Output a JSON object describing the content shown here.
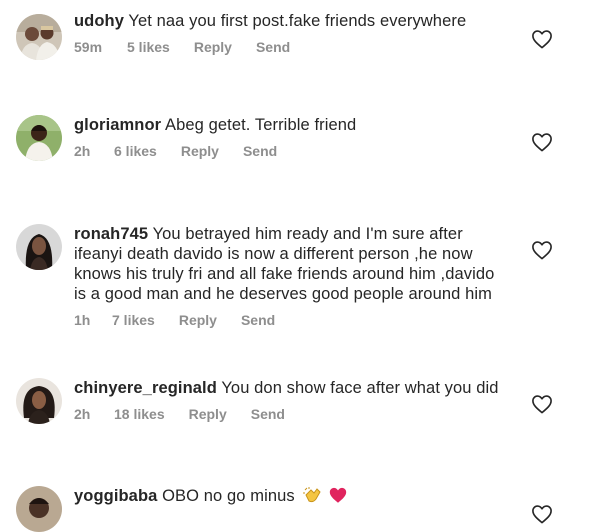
{
  "comments": [
    {
      "username": "udohy",
      "text": "Yet naa you first post.fake friends everywhere",
      "time": "59m",
      "likes": "5 likes",
      "reply": "Reply",
      "send": "Send"
    },
    {
      "username": "gloriamnor",
      "text": "Abeg getet. Terrible friend",
      "time": "2h",
      "likes": "6 likes",
      "reply": "Reply",
      "send": "Send"
    },
    {
      "username": "ronah745",
      "text": "You betrayed  him ready and I'm sure  after ifeanyi  death davido  is now a different  person ,he now knows his truly fri and all fake friends  around him ,davido  is a good man and he deserves  good people  around him",
      "time": "1h",
      "likes": "7 likes",
      "reply": "Reply",
      "send": "Send"
    },
    {
      "username": "chinyere_reginald",
      "text": "You don show face after what you did",
      "time": "2h",
      "likes": "18 likes",
      "reply": "Reply",
      "send": "Send"
    },
    {
      "username": "yoggibaba",
      "text": "OBO no go minus",
      "emojis": [
        "clapping-hands-emoji",
        "red-heart-emoji"
      ]
    }
  ],
  "icons": {
    "like": "heart-outline-icon"
  },
  "colors": {
    "text": "#262626",
    "meta": "#8e8e8e",
    "emoji_heart": "#e0245e",
    "emoji_clap": "#f4c542"
  }
}
